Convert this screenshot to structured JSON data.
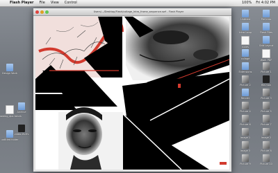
{
  "menubar": {
    "apple_glyph": "",
    "items": [
      "Flash Player",
      "File",
      "View",
      "Control"
    ],
    "right_items": [
      "100%",
      "Fri 4:02 PM"
    ]
  },
  "window": {
    "title": "Users/.../Desktop/Flash/collage_Intro_frame_sequence.swf - Flash Player"
  },
  "desktop_left": [
    {
      "label": "Design Work",
      "kind": "folder"
    },
    {
      "label": "Archive",
      "kind": "folder"
    },
    {
      "label": "showing_dps tutorial",
      "kind": "doc"
    },
    {
      "label": "video-DV.ffs",
      "kind": "dark"
    },
    {
      "label": "untitled folder",
      "kind": "folder"
    }
  ],
  "desktop_right": [
    {
      "label": "Untitled",
      "kind": "folder"
    },
    {
      "label": "Pre Intro",
      "kind": "folder"
    },
    {
      "label": "Intro Loop",
      "kind": "folder"
    },
    {
      "label": "Flash Files",
      "kind": "folder"
    },
    {
      "label": "notes",
      "kind": "doc"
    },
    {
      "label": "Grid Layout",
      "kind": "folder"
    },
    {
      "label": "collage",
      "kind": "folder"
    },
    {
      "label": "Work PDF",
      "kind": "doc"
    },
    {
      "label": "Extensions",
      "kind": "folder"
    },
    {
      "label": "Picture 1",
      "kind": "image"
    },
    {
      "label": "Picture 2",
      "kind": "image"
    },
    {
      "label": "file.mov",
      "kind": "dark"
    },
    {
      "label": "Render",
      "kind": "folder"
    },
    {
      "label": "Picture 3",
      "kind": "image"
    },
    {
      "label": "Picture 4",
      "kind": "image"
    },
    {
      "label": "Picture 5",
      "kind": "image"
    },
    {
      "label": "Picture 6",
      "kind": "image"
    },
    {
      "label": "Picture 7",
      "kind": "image"
    },
    {
      "label": "Image 1",
      "kind": "image"
    },
    {
      "label": "Image 2",
      "kind": "image"
    },
    {
      "label": "Image 3",
      "kind": "image"
    },
    {
      "label": "Picture 8",
      "kind": "image"
    },
    {
      "label": "Picture 9",
      "kind": "image"
    },
    {
      "label": "Picture 10",
      "kind": "image"
    }
  ],
  "colors": {
    "accent_red": "#d23a2e",
    "panel_pink": "#f1dfdc",
    "black": "#000000"
  }
}
